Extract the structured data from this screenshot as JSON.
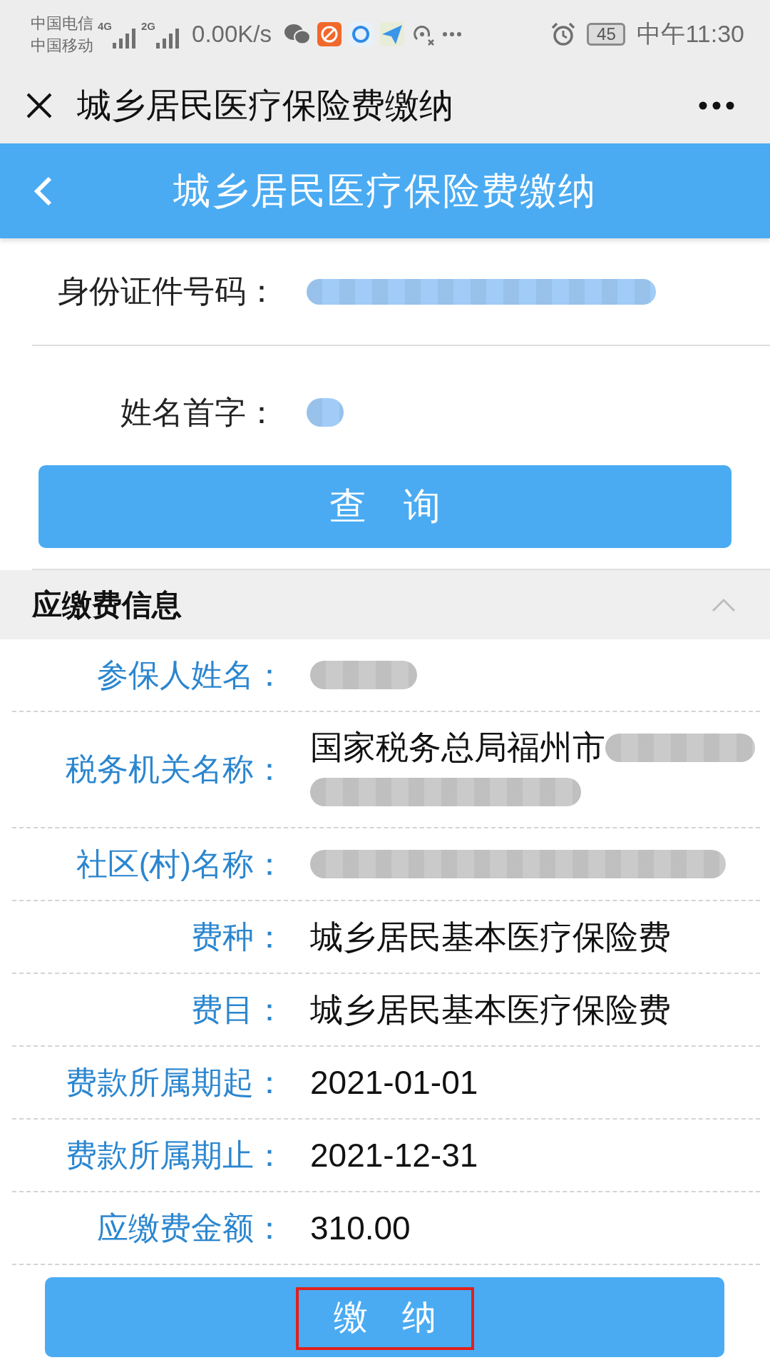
{
  "status_bar": {
    "carriers": [
      "中国电信",
      "中国移动"
    ],
    "networks": [
      "4G",
      "2G"
    ],
    "speed": "0.00K/s",
    "battery": "45",
    "time": "中午11:30"
  },
  "nav_bar": {
    "title": "城乡居民医疗保险费缴纳"
  },
  "header": {
    "title": "城乡居民医疗保险费缴纳"
  },
  "query_form": {
    "fields": [
      {
        "label": "身份证件号码：",
        "kind": "long"
      },
      {
        "label": "姓名首字：",
        "kind": "short"
      }
    ],
    "button": "查　询"
  },
  "section": {
    "title": "应缴费信息",
    "expanded": true,
    "rows": [
      {
        "label": "参保人姓名：",
        "kind": "medium"
      },
      {
        "label": "税务机关名称：",
        "value": "国家税务总局福州市",
        "kind": "wrap"
      },
      {
        "label": "社区(村)名称：",
        "kind": "long"
      },
      {
        "label": "费种：",
        "value": "城乡居民基本医疗保险费",
        "kind": "text"
      },
      {
        "label": "费目：",
        "value": "城乡居民基本医疗保险费",
        "kind": "text"
      },
      {
        "label": "费款所属期起：",
        "value": "2021-01-01",
        "kind": "text"
      },
      {
        "label": "费款所属期止：",
        "value": "2021-12-31",
        "kind": "text"
      },
      {
        "label": "应缴费金额：",
        "value": "310.00",
        "kind": "text"
      }
    ]
  },
  "pay_button": {
    "label": "缴　纳",
    "highlighted": true
  }
}
